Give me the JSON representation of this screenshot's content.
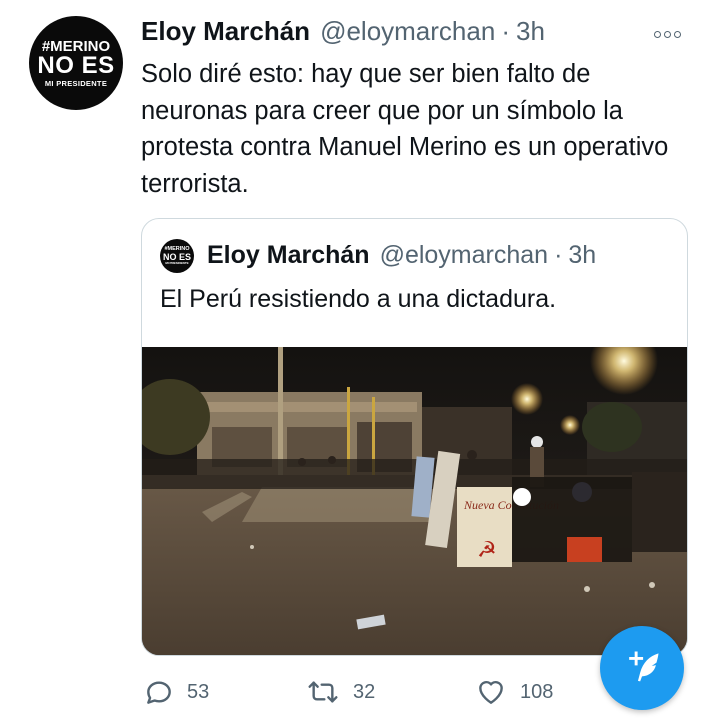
{
  "tweet": {
    "author_name": "Eloy Marchán",
    "handle": "@eloymarchan",
    "separator": "·",
    "time": "3h",
    "text": "Solo diré esto: hay que ser bien falto de neuronas para creer que por un símbolo la protesta contra Manuel Merino es un operativo terrorista."
  },
  "avatar": {
    "line1": "#MERINO",
    "line2": "NO ES",
    "line3": "MI PRESIDENTE"
  },
  "quoted_tweet": {
    "author_name": "Eloy Marchán",
    "handle": "@eloymarchan",
    "separator": "·",
    "time": "3h",
    "text": "El Perú resistiendo a una dictadura.",
    "photo_sign_text": "Nueva Constitución"
  },
  "actions": {
    "replies": "53",
    "retweets": "32",
    "likes": "108"
  },
  "icons": {
    "more": "more-options-icon",
    "reply": "reply-icon",
    "retweet": "retweet-icon",
    "like": "heart-icon",
    "compose": "compose-tweet-icon"
  },
  "colors": {
    "accent": "#1d9bf0",
    "secondary_text": "#536471",
    "border": "#cfd9de"
  }
}
